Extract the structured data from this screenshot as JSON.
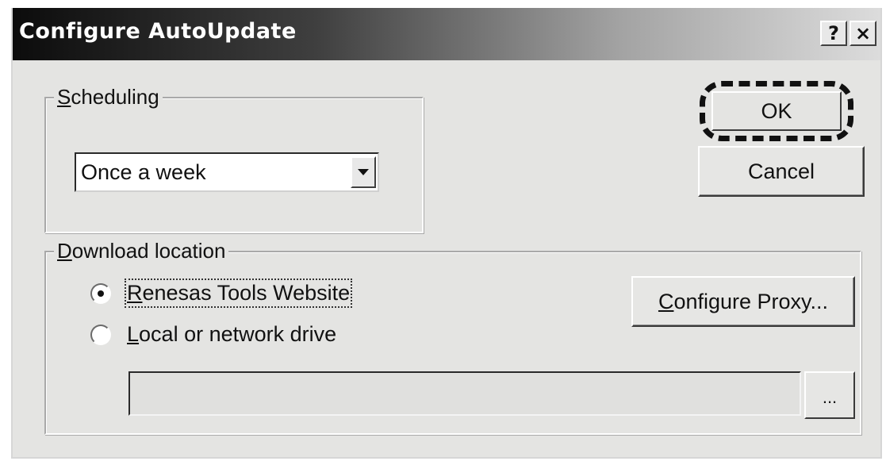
{
  "window": {
    "title": "Configure AutoUpdate",
    "help_label": "?",
    "close_label": "×"
  },
  "scheduling": {
    "label_accel": "S",
    "label_rest": "cheduling",
    "selected_value": "Once a week",
    "dropdown_icon": "chevron-down-icon"
  },
  "download": {
    "label_accel": "D",
    "label_rest": "ownload location",
    "options": [
      {
        "label_accel": "R",
        "label_rest": "enesas Tools Website",
        "checked": true
      },
      {
        "label_accel": "L",
        "label_rest": "ocal or network drive",
        "checked": false
      }
    ],
    "path_value": "",
    "browse_label": "...",
    "proxy_accel": "C",
    "proxy_rest": "onfigure Proxy..."
  },
  "buttons": {
    "ok_label": "OK",
    "cancel_label": "Cancel"
  },
  "colors": {
    "dialog_bg": "#e4e4e2",
    "title_gradient_start": "#0c0c0c",
    "title_gradient_end": "#dcdcdc"
  }
}
